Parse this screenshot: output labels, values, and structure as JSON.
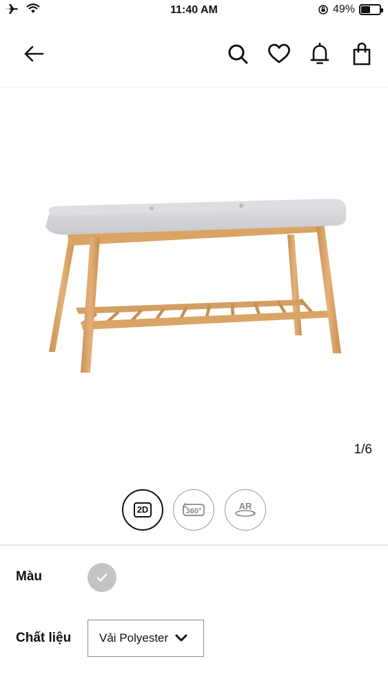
{
  "status_bar": {
    "time": "11:40 AM",
    "battery": "49%",
    "battery_level": 0.49
  },
  "header": {
    "icons": [
      "back-arrow-icon",
      "search-icon",
      "heart-icon",
      "bell-icon",
      "shopping-bag-icon"
    ]
  },
  "gallery": {
    "counter": "1/6",
    "view_modes": [
      {
        "label": "2D",
        "active": true
      },
      {
        "label": "360°",
        "active": false
      },
      {
        "label": "AR",
        "active": false
      }
    ]
  },
  "options": {
    "color_label": "Màu",
    "material_label": "Chất liệu",
    "material_value": "Vải Polyester"
  },
  "colors": {
    "wood": "#d9a465",
    "cushion": "#d7d9dc",
    "swatch": "#c4c4c4"
  }
}
